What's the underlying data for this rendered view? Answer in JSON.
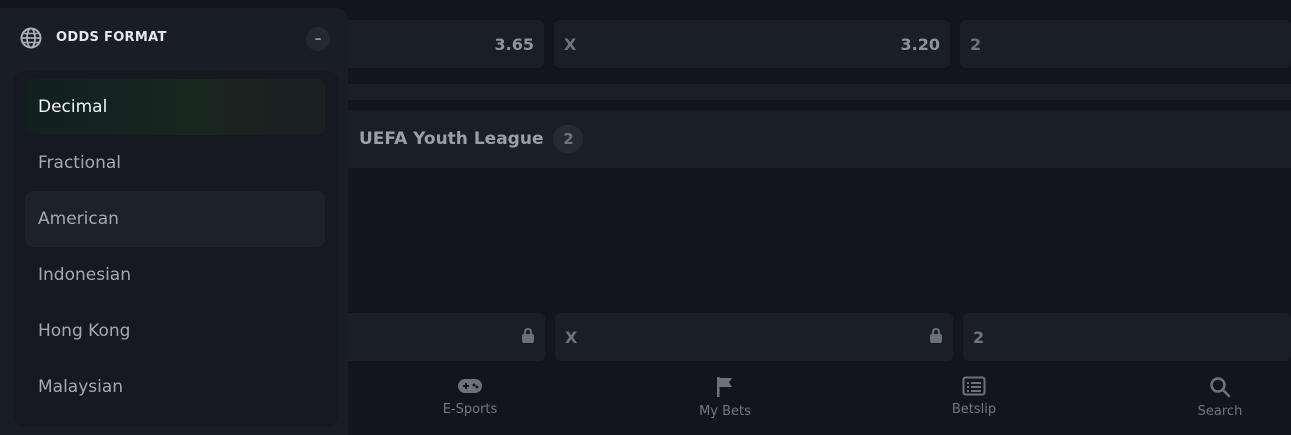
{
  "odds_rows": [
    {
      "home_value": "3.65",
      "draw_label": "X",
      "draw_value": "3.20",
      "away_label": "2"
    },
    {
      "draw_label": "X",
      "away_label": "2"
    }
  ],
  "league": {
    "name": "UEFA Youth League",
    "count": "2"
  },
  "bottom_nav": [
    {
      "label": "E-Sports",
      "icon": "gamepad-icon"
    },
    {
      "label": "My Bets",
      "icon": "flag-icon"
    },
    {
      "label": "Betslip",
      "icon": "betslip-icon"
    },
    {
      "label": "Search",
      "icon": "search-icon"
    }
  ],
  "odds_format_panel": {
    "title": "ODDS FORMAT",
    "collapse_symbol": "–",
    "selected": "Decimal",
    "options": [
      "Decimal",
      "Fractional",
      "American",
      "Indonesian",
      "Hong Kong",
      "Malaysian"
    ]
  },
  "colors": {
    "background": "#12151b",
    "panel": "#191d24",
    "active_option": "#182620"
  }
}
